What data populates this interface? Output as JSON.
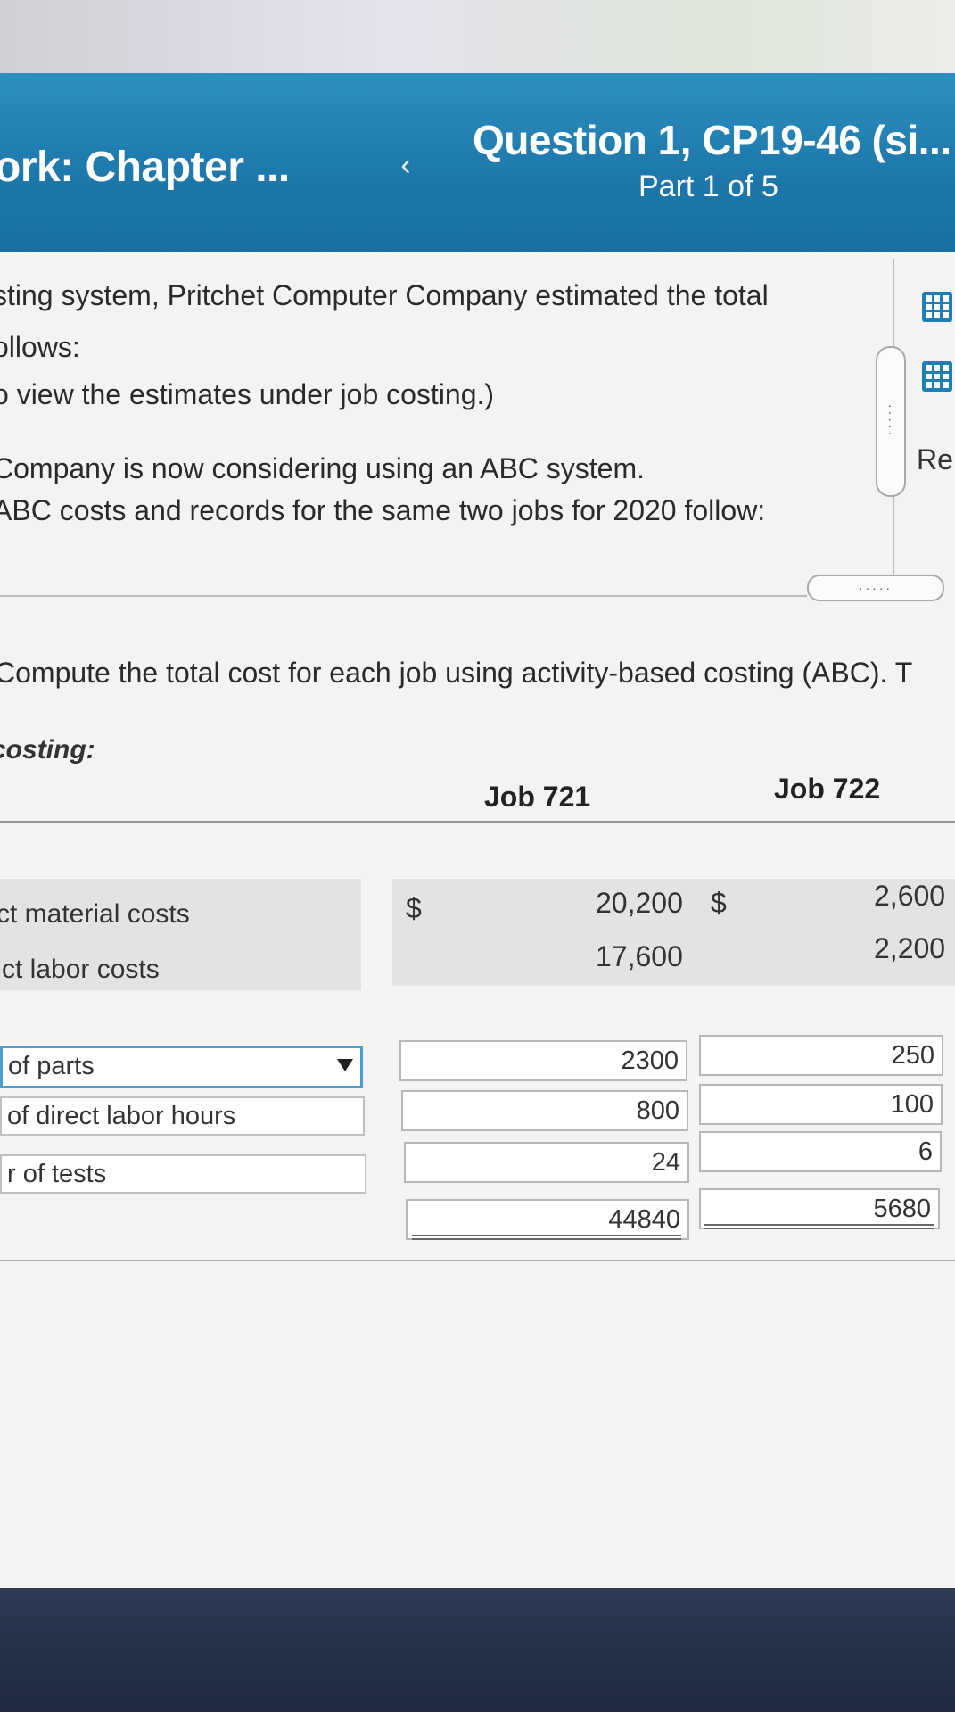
{
  "header": {
    "chapter_title": "ork: Chapter ...",
    "question_title": "Question 1, CP19-46 (si...",
    "part": "Part 1 of 5"
  },
  "intro": {
    "line1": "sting system, Pritchet Computer Company estimated the total",
    "line2": "ollows:",
    "line3": "o view the estimates under job costing.)",
    "line4": "Company is now considering using an ABC system.",
    "line5": "ABC costs and records for the same two jobs for 2020 follow:"
  },
  "side_panel": {
    "icon1": "data-table-icon",
    "icon2": "data-table-icon",
    "label": "Re",
    "handle_dots": "·····"
  },
  "question": {
    "text": "Compute the total cost for each job using activity-based costing (ABC). T",
    "section_label": "costing:"
  },
  "table": {
    "col_job721": "Job 721",
    "col_job722": "Job 722",
    "given_rows": [
      {
        "label": "ct material costs",
        "cur721": "$",
        "job721": "20,200",
        "cur722": "$",
        "job722": "2,600"
      },
      {
        "label": "ct labor costs",
        "job721": "17,600",
        "job722": "2,200"
      }
    ],
    "input_rows": [
      {
        "label": "of parts",
        "job721": "2300",
        "job722": "250"
      },
      {
        "label": "of direct labor hours",
        "job721": "800",
        "job722": "100"
      },
      {
        "label": "r of tests",
        "job721": "24",
        "job722": "6"
      }
    ],
    "totals": {
      "job721": "44840",
      "job722": "5680"
    }
  }
}
